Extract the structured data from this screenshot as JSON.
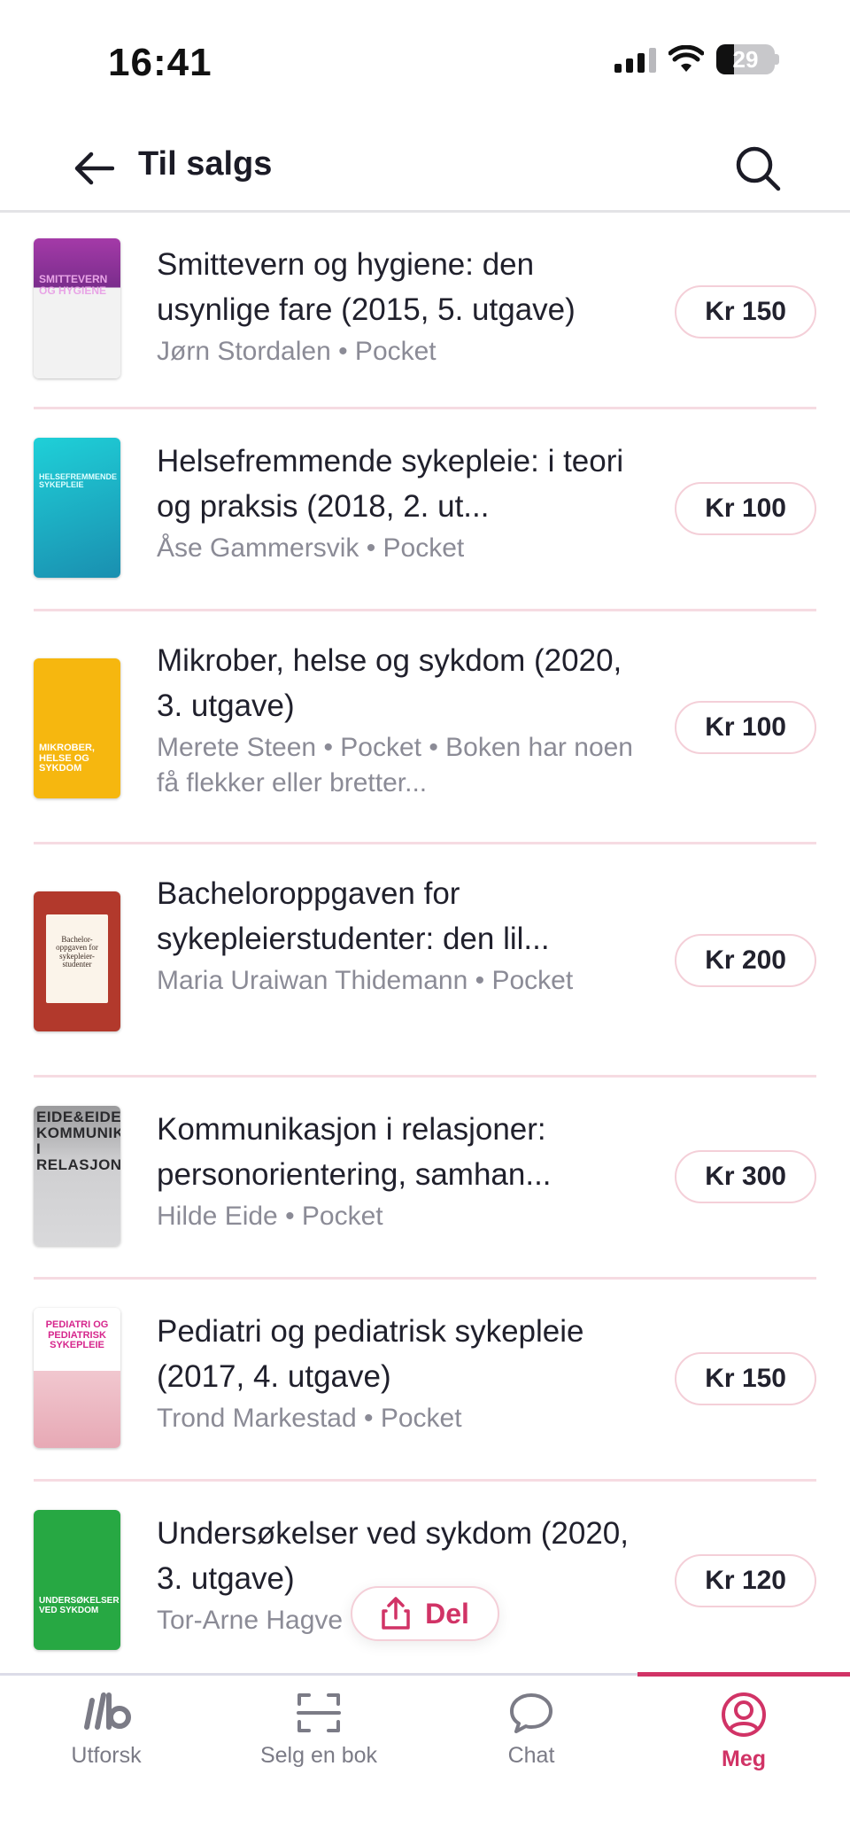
{
  "status_bar": {
    "time": "16:41",
    "battery": "29"
  },
  "header": {
    "title": "Til salgs",
    "back_icon": "arrow-left-icon",
    "search_icon": "search-icon"
  },
  "books": [
    {
      "title": "Smittevern og hygiene: den usynlige fare (2015, 5. utgave)",
      "meta": "Jørn Stordalen • Pocket",
      "price": "Kr 150",
      "cover_color": "#7a2d8c",
      "cover_text": "SMITTEVERN OG HYGIENE"
    },
    {
      "title": "Helsefremmende sykepleie: i teori og praksis (2018, 2. ut...",
      "meta": "Åse Gammersvik • Pocket",
      "price": "Kr 100",
      "cover_color": "#1bb7c4",
      "cover_text": "HELSEFREMMENDE SYKEPLEIE"
    },
    {
      "title": "Mikrober, helse og sykdom (2020, 3. utgave)",
      "meta": "Merete Steen • Pocket • Boken har noen få flekker eller bretter...",
      "price": "Kr 100",
      "cover_color": "#f6b70f",
      "cover_text": "MIKROBER, HELSE OG SYKDOM"
    },
    {
      "title": "Bacheloroppgaven for sykepleierstudenter: den lil...",
      "meta": "Maria Uraiwan Thidemann • Pocket",
      "price": "Kr 200",
      "cover_color": "#b2392c",
      "cover_text": "Bachelor-oppgaven for sykepleier-studenter"
    },
    {
      "title": "Kommunikasjon i relasjoner: personorientering, samhan...",
      "meta": "Hilde Eide • Pocket",
      "price": "Kr 300",
      "cover_color": "#c9c9cb",
      "cover_text": "EIDE&EIDE KOMMUNIKASJON I RELASJONER"
    },
    {
      "title": "Pediatri og pediatrisk sykepleie (2017, 4. utgave)",
      "meta": "Trond Markestad • Pocket",
      "price": "Kr 150",
      "cover_color": "#f4f1f3",
      "cover_text": "PEDIATRI OG PEDIATRISK SYKEPLEIE"
    },
    {
      "title": "Undersøkelser ved sykdom (2020, 3. utgave)",
      "meta": "Tor-Arne Hagve",
      "price": "Kr 120",
      "cover_color": "#27a843",
      "cover_text": "UNDERSØKELSER VED SYKDOM"
    }
  ],
  "share": {
    "label": "Del",
    "icon": "share-icon"
  },
  "tabs": [
    {
      "label": "Utforsk",
      "icon": "logo-lb-icon"
    },
    {
      "label": "Selg en bok",
      "icon": "scan-icon"
    },
    {
      "label": "Chat",
      "icon": "chat-bubble-icon"
    },
    {
      "label": "Meg",
      "icon": "user-circle-icon"
    }
  ],
  "colors": {
    "accent": "#d13366",
    "divider": "#f6dbe2"
  }
}
